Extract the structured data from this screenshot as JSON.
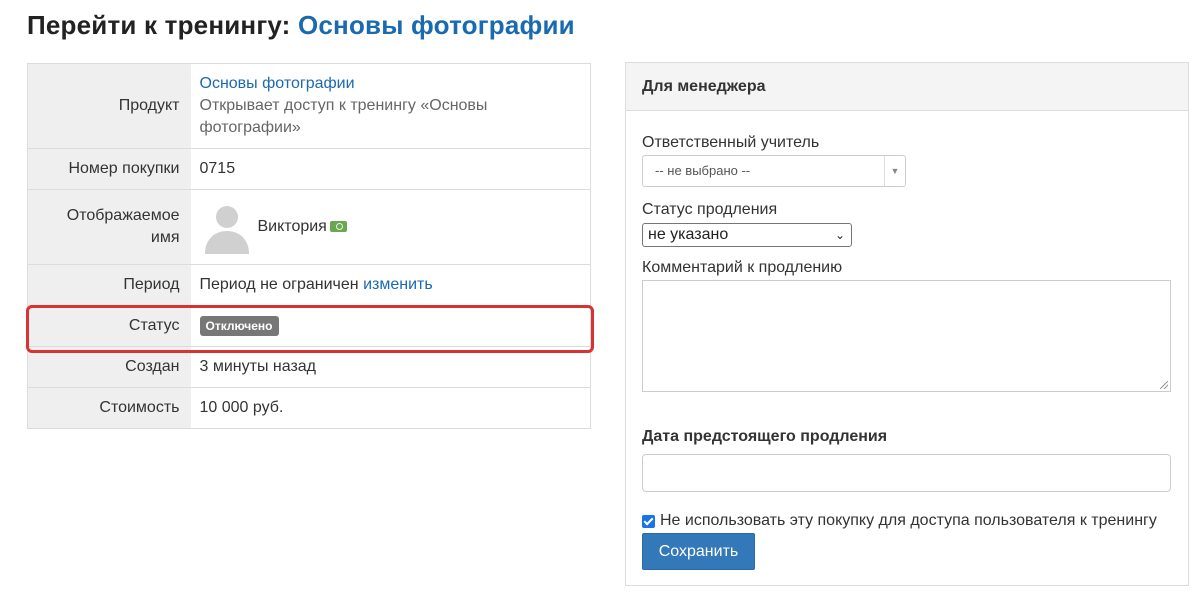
{
  "header": {
    "title_prefix": "Перейти к тренингу:",
    "training_link": "Основы фотографии"
  },
  "details": {
    "product_label": "Продукт",
    "product_link": "Основы фотографии",
    "product_desc": "Открывает доступ к тренингу «Основы фотографии»",
    "purchase_number_label": "Номер покупки",
    "purchase_number": "0715",
    "display_name_label": "Отображаемое имя",
    "display_name": "Виктория",
    "period_label": "Период",
    "period_text": "Период не ограничен",
    "period_change_link": "изменить",
    "status_label": "Статус",
    "status_badge": "Отключено",
    "created_label": "Создан",
    "created_value": "3 минуты назад",
    "cost_label": "Стоимость",
    "cost_value": "10 000 руб."
  },
  "manager_panel": {
    "title": "Для менеджера",
    "teacher_label": "Ответственный учитель",
    "teacher_value": "-- не выбрано --",
    "renewal_status_label": "Статус продления",
    "renewal_status_value": "не указано",
    "comment_label": "Комментарий к продлению",
    "comment_value": "",
    "date_label": "Дата предстоящего продления",
    "date_value": "",
    "checkbox_label": "Не использовать эту покупку для доступа пользователя к тренингу",
    "checkbox_checked": true,
    "save_button": "Сохранить"
  },
  "colors": {
    "link": "#1a6ab0",
    "badge_bg": "#777777",
    "highlight": "#d93232",
    "button": "#3378b8"
  }
}
